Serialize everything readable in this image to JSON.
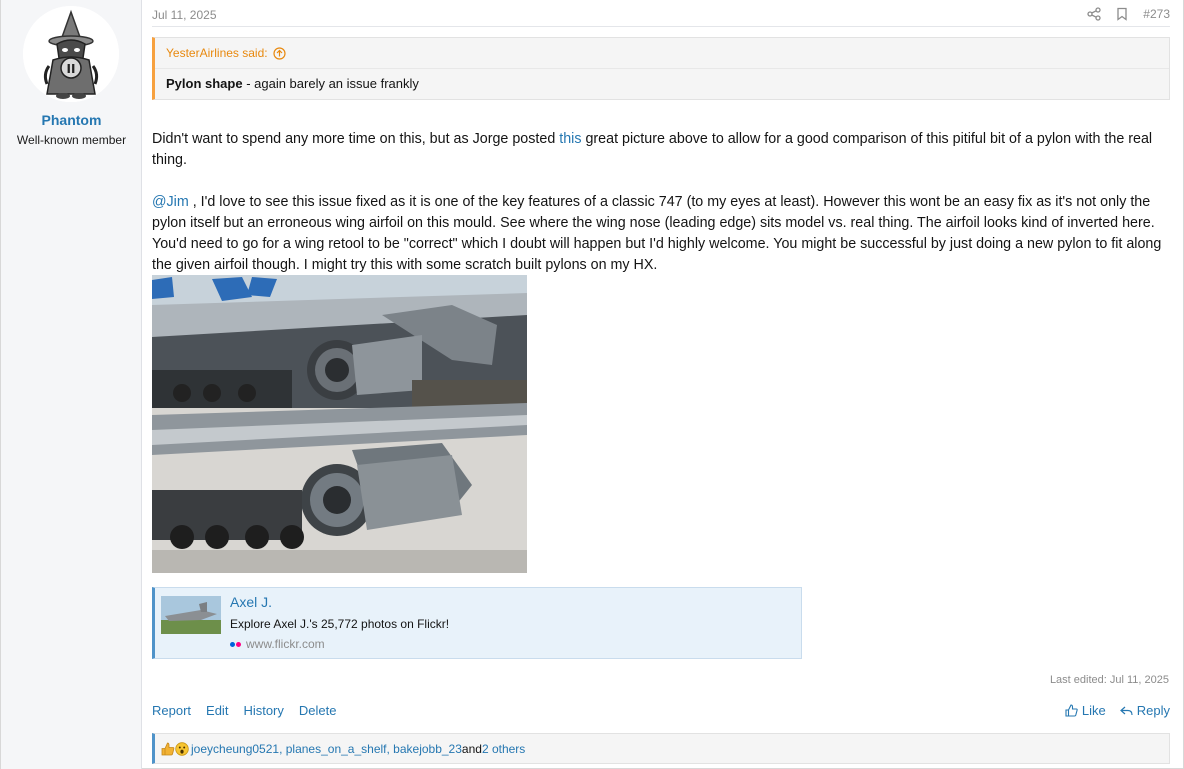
{
  "user": {
    "name": "Phantom",
    "title": "Well-known member",
    "avatar_text": "II"
  },
  "post": {
    "date": "Jul 11, 2025",
    "number": "#273",
    "quote": {
      "author": "YesterAirlines said:",
      "bold": "Pylon shape",
      "text": " - again barely an issue frankly"
    },
    "paragraph1": {
      "before": "Didn't want to spend any more time on this, but as Jorge posted ",
      "link": "this",
      "after": " great picture above to allow for a good comparison of this pitiful bit of a pylon with the real thing."
    },
    "paragraph2": {
      "mention": "@Jim",
      "text": " , I'd love to see this issue fixed as it is one of the key features of a classic 747 (to my eyes at least). However this wont be an easy fix as it's not only the pylon itself but an erroneous wing airfoil on this mould. See where the wing nose (leading edge) sits model vs. real thing. The airfoil looks kind of inverted here. You'd need to go for a wing retool to be \"correct\" which I doubt will happen but I'd highly welcome. You might be successful by just doing a new pylon to fit along the given airfoil though. I might try this with some scratch built pylons on my HX."
    },
    "embed": {
      "title": "Axel J.",
      "description": "Explore Axel J.'s 25,772 photos on Flickr!",
      "site": "www.flickr.com"
    },
    "last_edited": "Last edited: Jul 11, 2025",
    "actions": {
      "report": "Report",
      "edit": "Edit",
      "history": "History",
      "delete": "Delete",
      "like": "Like",
      "reply": "Reply"
    },
    "reactions": {
      "users": "joeycheung0521, planes_on_a_shelf, bakejobb_23",
      "and": " and ",
      "others": "2 others"
    }
  },
  "colors": {
    "link": "#2577b1",
    "quote_accent": "#f7a13f",
    "sidebar_bg": "#f5f6f8"
  },
  "icons": [
    "share-icon",
    "bookmark-icon",
    "arrow-up-circle-icon",
    "thumbs-up-icon",
    "reply-icon",
    "flickr-icon",
    "like-reaction-icon",
    "wow-reaction-icon"
  ]
}
